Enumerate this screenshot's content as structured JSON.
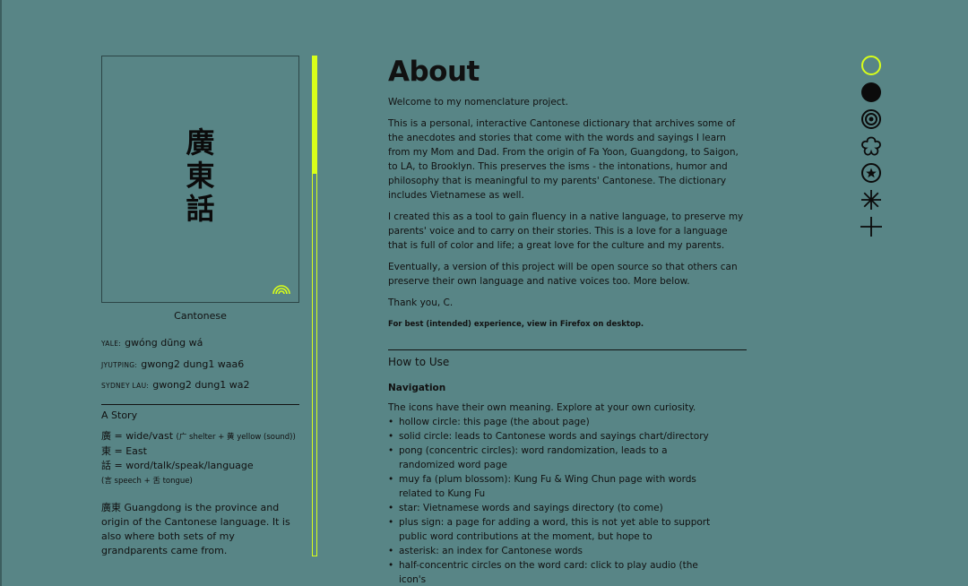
{
  "card": {
    "hanzi": [
      "廣",
      "東",
      "話"
    ],
    "caption": "Cantonese"
  },
  "pronunciations": [
    {
      "label": "YALE:",
      "value": "gwóng dūng wá"
    },
    {
      "label": "JYUTPING:",
      "value": "gwong2 dung1 waa6"
    },
    {
      "label": "SYDNEY LAU:",
      "value": "gwong2 dung1 wa2"
    }
  ],
  "story": {
    "heading": "A Story",
    "lines": [
      {
        "main": "廣 = wide/vast",
        "note": "(广 shelter + 黄 yellow (sound))"
      },
      {
        "main": "東 = East",
        "note": ""
      },
      {
        "main": "話 = word/talk/speak/language",
        "note": ""
      },
      {
        "main": "",
        "note": "(言 speech + 舌 tongue)"
      }
    ],
    "paragraph": "廣東 Guangdong is the province and origin of the Cantonese language. It is also where both sets of my grandparents came from."
  },
  "progress": {
    "fraction": 0.236
  },
  "main": {
    "title": "About",
    "paragraphs": [
      "Welcome to my nomenclature project.",
      "This is a personal, interactive Cantonese dictionary that archives some of the anecdotes and stories that come with the words and sayings I learn from my Mom and Dad. From the origin of Fa Yoon, Guangdong, to Saigon, to LA, to Brooklyn. This preserves the isms - the intonations, humor and philosophy that is meaningful to my parents' Cantonese. The dictionary includes Vietnamese as well.",
      "I created this as a tool to gain fluency in a native language, to preserve my parents' voice and to carry on their stories. This is a love for a language that is full of color and life; a great love for the culture and my parents.",
      "Eventually, a version of this project will be open source so that others can preserve their own language and native voices too. More below.",
      "Thank you, C."
    ],
    "note": "For best (intended) experience, view in Firefox on desktop.",
    "how_to_use": "How to Use",
    "navigation": {
      "heading": "Navigation",
      "intro": "The icons have their own meaning. Explore at your own curiosity.",
      "items": [
        "hollow circle: this page (the about page)",
        "solid circle: leads to Cantonese words and sayings chart/directory",
        "pong (concentric circles): word randomization, leads to a randomized word page",
        "muy fa (plum blossom): Kung Fu & Wing Chun page with words related to Kung Fu",
        "star: Vietnamese words and sayings directory (to come)",
        "plus sign: a page for adding a word, this is not yet able to support public word contributions at the moment, but hope to",
        "asterisk: an index for Cantonese words",
        "half-concentric circles on the word card: click to play audio (the icon's"
      ]
    }
  },
  "icon_nav": [
    {
      "name": "hollow-circle-icon",
      "color": "#d8ff1a"
    },
    {
      "name": "solid-circle-icon",
      "color": "#0b0b0b"
    },
    {
      "name": "concentric-circles-icon",
      "color": "#0b0b0b"
    },
    {
      "name": "plum-blossom-icon",
      "color": "#0b0b0b"
    },
    {
      "name": "star-circle-icon",
      "color": "#0b0b0b"
    },
    {
      "name": "asterisk-icon",
      "color": "#0b0b0b"
    },
    {
      "name": "plus-icon",
      "color": "#0b0b0b"
    }
  ],
  "colors": {
    "background": "#588586",
    "accent": "#d8ff1a",
    "text": "#111111"
  }
}
